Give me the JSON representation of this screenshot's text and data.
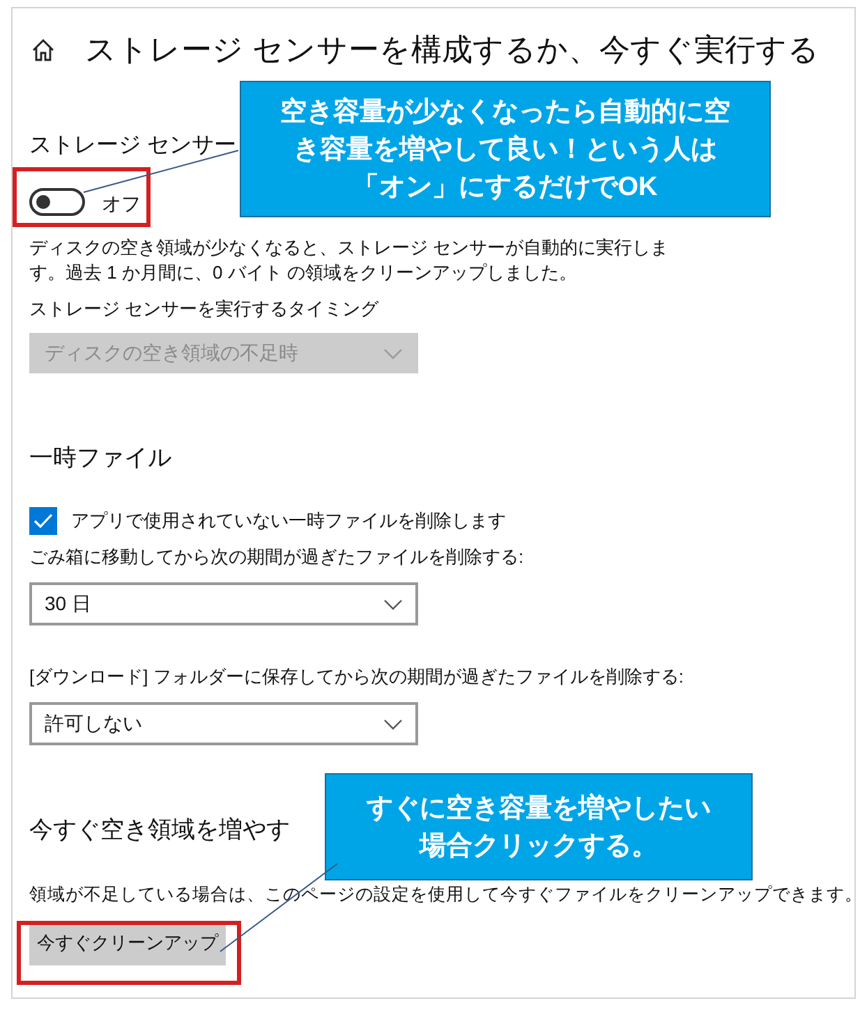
{
  "window": {
    "title": "ストレージ センサーを構成するか、今すぐ実行する"
  },
  "storage_sense": {
    "heading": "ストレージ センサー",
    "toggle": {
      "on": false,
      "label": "オフ"
    },
    "description": "ディスクの空き領域が少なくなると、ストレージ センサーが自動的に実行します。過去 1 か月間に、0 バイト の領域をクリーンアップしました。",
    "timing_label": "ストレージ センサーを実行するタイミング",
    "timing_dropdown": {
      "value": "ディスクの空き領域の不足時",
      "disabled": true
    }
  },
  "temporary_files": {
    "heading": "一時ファイル",
    "checkbox": {
      "label": "アプリで使用されていない一時ファイルを削除します",
      "checked": true
    },
    "settings": [
      {
        "label": "ごみ箱に移動してから次の期間が過ぎたファイルを削除する:",
        "dropdown": {
          "value": "30 日",
          "disabled": false
        }
      },
      {
        "label": "[ダウンロード] フォルダーに保存してから次の期間が過ぎたファイルを削除する:",
        "dropdown": {
          "value": "許可しない",
          "disabled": false
        }
      }
    ]
  },
  "free_space_now": {
    "heading": "今すぐ空き領域を増やす",
    "description": "領域が不足している場合は、このページの設定を使用して今すぐファイルをクリーンアップできます。",
    "button": "今すぐクリーンアップ"
  },
  "annotations": [
    {
      "text": "空き容量が少なくなったら自動的に空き容量を増やして良い！という人は「オン」にするだけでOK"
    },
    {
      "text": "すぐに空き容量を増やしたい場合クリックする。"
    }
  ]
}
